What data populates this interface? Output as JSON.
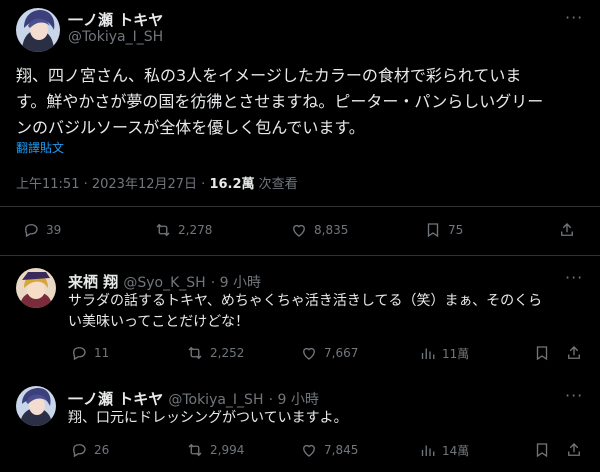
{
  "main_tweet": {
    "author_name": "一ノ瀬 トキヤ",
    "author_handle": "@Tokiya_I_SH",
    "text_line1": "翔、四ノ宮さん、私の3人をイメージしたカラーの食材で彩られていま",
    "text_line2": "す。鮮やかさが夢の国を彷彿とさせますね。ピーター・パンらしいグリー",
    "text_line3": "ンのバジルソースが全体を優しく包んでいます。",
    "translate_label": "翻譯貼文",
    "timestamp": "上午11:51 · 2023年12月27日 · ",
    "views_count": "16.2萬",
    "views_label": " 次查看",
    "replies": "39",
    "retweets": "2,278",
    "likes": "8,835",
    "bookmarks": "75"
  },
  "reply1": {
    "author_name": "来栖 翔",
    "author_handle": "@Syo_K_SH",
    "time": "· 9 小時",
    "text_line1": "サラダの話するトキヤ、めちゃくちゃ活き活きしてる（笑）まぁ、そのくら",
    "text_line2": "い美味いってことだけどな！",
    "replies": "11",
    "retweets": "2,252",
    "likes": "7,667",
    "views": "11萬"
  },
  "reply2": {
    "author_name": "一ノ瀬 トキヤ",
    "author_handle": "@Tokiya_I_SH",
    "time": "· 9 小時",
    "text_line1": "翔、口元にドレッシングがついていますよ。",
    "replies": "26",
    "retweets": "2,994",
    "likes": "7,845",
    "views": "14萬"
  },
  "colors": {
    "background": "#000000",
    "text": "#e7e9ea",
    "secondary": "#71767b",
    "link": "#1d9bf0",
    "divider": "#2f3336"
  }
}
